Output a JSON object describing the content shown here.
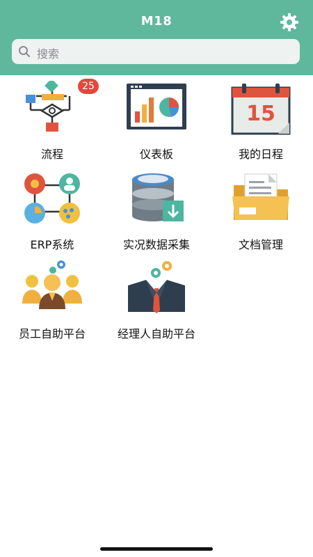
{
  "header": {
    "title": "M18",
    "settings_icon": "gear-icon"
  },
  "search": {
    "placeholder": "搜索",
    "icon": "search-icon"
  },
  "apps": [
    {
      "label": "流程",
      "icon": "flowchart-icon",
      "badge": "25"
    },
    {
      "label": "仪表板",
      "icon": "dashboard-icon"
    },
    {
      "label": "我的日程",
      "icon": "calendar-icon"
    },
    {
      "label": "ERP系统",
      "icon": "erp-network-icon"
    },
    {
      "label": "实况数据采集",
      "icon": "database-download-icon"
    },
    {
      "label": "文档管理",
      "icon": "folder-documents-icon"
    },
    {
      "label": "员工自助平台",
      "icon": "employee-team-icon"
    },
    {
      "label": "经理人自助平台",
      "icon": "manager-icon"
    }
  ],
  "calendar_day": "15",
  "colors": {
    "header": "#5fb89b",
    "badge": "#e8453c",
    "search_bg": "#eef2f1"
  }
}
